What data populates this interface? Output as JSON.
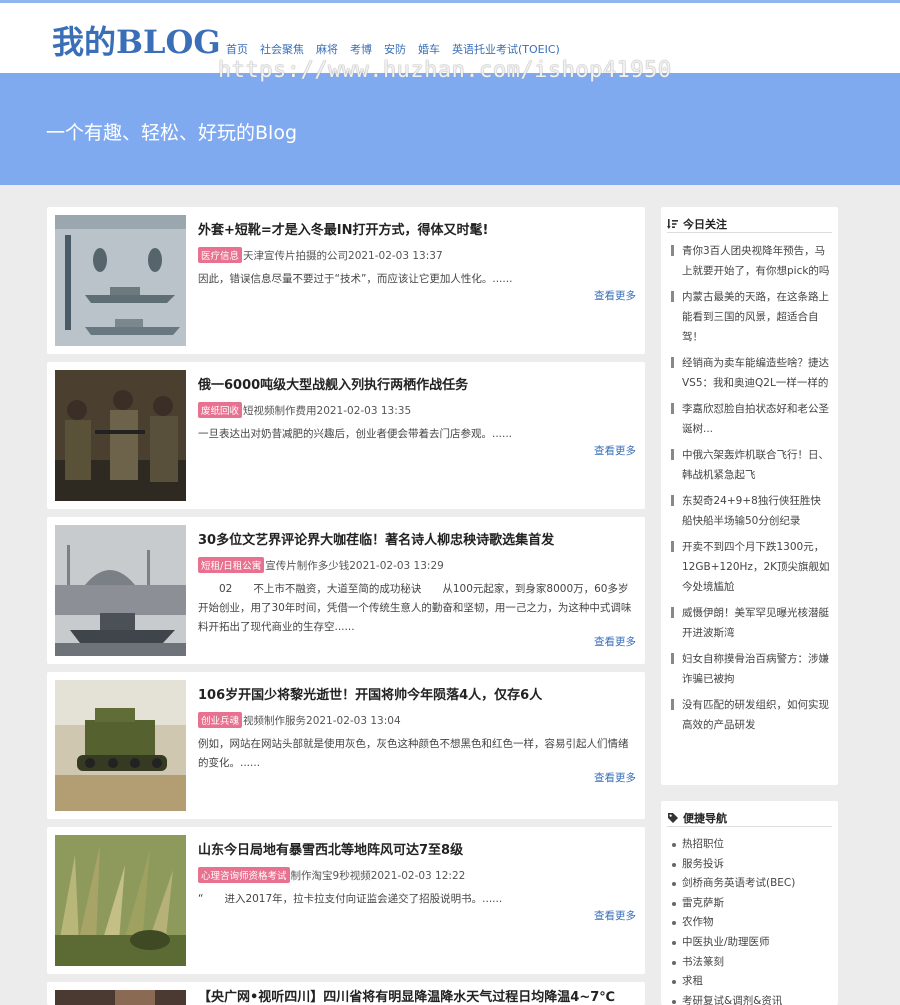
{
  "site": {
    "logo": "我的BLOG",
    "nav": [
      "首页",
      "社会聚焦",
      "麻将",
      "考博",
      "安防",
      "婚车",
      "英语托业考试(TOEIC)"
    ],
    "watermark": "https://www.huzhan.com/ishop41950",
    "slogan": "一个有趣、轻松、好玩的Blog"
  },
  "posts": [
    {
      "title": "外套+短靴=才是入冬最IN打开方式，得体又时髦!",
      "tag": "医疗信息",
      "meta": "天津宣传片拍摄的公司2021-02-03 13:37",
      "excerpt": "因此，错误信息尽量不要过于“技术”，而应该让它更加人性化。......",
      "more": "查看更多"
    },
    {
      "title": "俄一6000吨级大型战舰入列执行两栖作战任务",
      "tag": "废纸回收",
      "meta": "短视频制作费用2021-02-03 13:35",
      "excerpt": "一旦表达出对奶昔减肥的兴趣后，创业者便会带着去门店参观。......",
      "more": "查看更多"
    },
    {
      "title": "30多位文艺界评论界大咖荏临！著名诗人柳忠秧诗歌选集首发",
      "tag": "短租/日租公寓",
      "meta": "宣传片制作多少钱2021-02-03 13:29",
      "excerpt": "　　02　　不上市不融资，大道至简的成功秘诀　　从100元起家，到身家8000万，60多岁开始创业，用了30年时间，凭借一个传统生意人的勤奋和坚韧，用一己之力，为这种中式调味料开拓出了现代商业的生存空......",
      "more": "查看更多"
    },
    {
      "title": "106岁开国少将黎光逝世！开国将帅今年陨落4人，仅存6人",
      "tag": "创业兵魂",
      "meta": "视频制作服务2021-02-03 13:04",
      "excerpt": "例如，网站在网站头部就是使用灰色，灰色这种颜色不想黑色和红色一样，容易引起人们情绪的变化。......",
      "more": "查看更多"
    },
    {
      "title": "山东今日局地有暴雪西北等地阵风可达7至8级",
      "tag": "心理咨询师资格考试",
      "meta": "制作淘宝9秒视频2021-02-03 12:22",
      "excerpt": "“　　进入2017年，拉卡拉支付向证监会递交了招股说明书。......",
      "more": "查看更多"
    },
    {
      "title": "【央广网•视听四川】四川省将有明显降温降水天气过程日均降温4~7℃",
      "tag": "",
      "meta": "",
      "excerpt": "",
      "more": ""
    }
  ],
  "sidebar": {
    "hot_title": "今日关注",
    "hot": [
      "青你3百人团央视降年预告，马上就要开始了，有你想pick的吗",
      "内蒙古最美的天路，在这条路上能看到三国的风景，超适合自驾！",
      "经销商为卖车能编造些啥？捷达VS5：我和奥迪Q2L一样一样的",
      "李嘉欣怼脸自拍状态好和老公圣诞树...",
      "中俄六架轰炸机联合飞行！日、韩战机紧急起飞",
      "东契奇24+9+8独行侠狂胜快船快船半场输50分创纪录",
      "开卖不到四个月下跌1300元，12GB+120Hz，2K顶尖旗舰如今处境尴尬",
      "威慑伊朗！美军罕见曝光核潜艇开进波斯湾",
      "妇女自称摸骨治百病警方：涉嫌诈骗已被拘",
      "没有匹配的研发组织，如何实现高效的产品研发"
    ],
    "nav_title": "便捷导航",
    "links": [
      "热招职位",
      "服务投诉",
      "剑桥商务英语考试(BEC)",
      "雷克萨斯",
      "农作物",
      "中医执业/助理医师",
      "书法篆刻",
      "求租",
      "考研复试&调剂&资讯"
    ]
  },
  "colors": {
    "accent": "#3a6fb8",
    "hero": "#80aaf0",
    "tag": "#e8718f"
  }
}
